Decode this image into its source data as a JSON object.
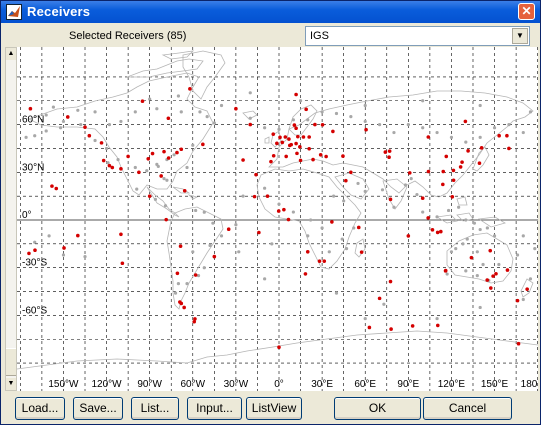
{
  "window": {
    "title": "Receivers",
    "close_glyph": "✕"
  },
  "header": {
    "selected_label": "Selected Receivers (85)"
  },
  "network_select": {
    "value": "IGS",
    "arrow_glyph": "▼"
  },
  "scrollbar": {
    "up_glyph": "▲",
    "down_glyph": "▼"
  },
  "map": {
    "lat_labels": [
      "60°N",
      "30°N",
      "0°",
      "-30°S",
      "-60°S"
    ],
    "lon_labels": [
      "150°W",
      "120°W",
      "90°W",
      "60°W",
      "30°W",
      "0°",
      "30°E",
      "60°E",
      "90°E",
      "120°E",
      "150°E",
      "180"
    ],
    "colors": {
      "grid": "#000000",
      "coast": "#b5b5b5",
      "receiver": "#d40000",
      "candidate": "#a8a8a8"
    },
    "selected_receivers": [
      [
        -147,
        64.8
      ],
      [
        -135,
        58.4
      ],
      [
        -123.5,
        48.5
      ],
      [
        -122,
        37.4
      ],
      [
        -118,
        34.2
      ],
      [
        -116,
        33
      ],
      [
        -110,
        32.2
      ],
      [
        -105,
        40
      ],
      [
        -97.5,
        30
      ],
      [
        -91,
        38.5
      ],
      [
        -88,
        41.8
      ],
      [
        -80,
        43
      ],
      [
        -76.8,
        39
      ],
      [
        -71,
        42.4
      ],
      [
        -68,
        44.5
      ],
      [
        -82,
        27.7
      ],
      [
        -65.6,
        18.4
      ],
      [
        -77,
        64
      ],
      [
        -62,
        82.5
      ],
      [
        -95,
        74.7
      ],
      [
        -53,
        47.6
      ],
      [
        -45,
        -23
      ],
      [
        -35,
        -5.8
      ],
      [
        -58,
        -34.6
      ],
      [
        -68.5,
        -16.5
      ],
      [
        -78.5,
        0.2
      ],
      [
        -70.7,
        -33.5
      ],
      [
        -69,
        -51.6
      ],
      [
        -68,
        -52.5
      ],
      [
        -59,
        -64
      ],
      [
        -66,
        -55
      ],
      [
        -140,
        -9.8
      ],
      [
        -155,
        19.8
      ],
      [
        -158,
        21.3
      ],
      [
        -149.6,
        -17.6
      ],
      [
        -109,
        -27.2
      ],
      [
        -25,
        37.7
      ],
      [
        -16,
        28.5
      ],
      [
        -17,
        14.7
      ],
      [
        -14,
        -7.9
      ],
      [
        -5.6,
        36.7
      ],
      [
        -3.7,
        40.4
      ],
      [
        2.3,
        48.8
      ],
      [
        -1.5,
        48.2
      ],
      [
        0.7,
        52
      ],
      [
        4.4,
        52.2
      ],
      [
        6.9,
        50.9
      ],
      [
        8.5,
        47.4
      ],
      [
        11.9,
        48.1
      ],
      [
        13.1,
        52.4
      ],
      [
        7.5,
        46.9
      ],
      [
        11.9,
        57.7
      ],
      [
        10.7,
        59.7
      ],
      [
        18.9,
        69.6
      ],
      [
        11.9,
        78.9
      ],
      [
        17,
        52.2
      ],
      [
        21,
        52.2
      ],
      [
        21,
        44.8
      ],
      [
        14.5,
        46
      ],
      [
        12.5,
        41.9
      ],
      [
        15,
        37.5
      ],
      [
        23.7,
        38
      ],
      [
        30.3,
        59.9
      ],
      [
        37.5,
        55.7
      ],
      [
        32.8,
        39.9
      ],
      [
        29,
        41
      ],
      [
        36.8,
        -1.2
      ],
      [
        31.5,
        -25.9
      ],
      [
        28.2,
        -25.9
      ],
      [
        18.4,
        -33.9
      ],
      [
        6.6,
        0.3
      ],
      [
        -0.2,
        5.6
      ],
      [
        3.4,
        6.5
      ],
      [
        46.5,
        24.7
      ],
      [
        57.5,
        -20.2
      ],
      [
        70,
        -49.3
      ],
      [
        77.6,
        13
      ],
      [
        77,
        43.3
      ],
      [
        76.6,
        39.5
      ],
      [
        74,
        42.7
      ],
      [
        91,
        29.6
      ],
      [
        104,
        30.5
      ],
      [
        114.3,
        30.5
      ],
      [
        116.4,
        40
      ],
      [
        121.4,
        31.2
      ],
      [
        126.4,
        33.4
      ],
      [
        127.4,
        36.4
      ],
      [
        139.5,
        35.7
      ],
      [
        141,
        45.4
      ],
      [
        131.6,
        43.5
      ],
      [
        153.2,
        53
      ],
      [
        158.6,
        53
      ],
      [
        114,
        22.4
      ],
      [
        121.5,
        25
      ],
      [
        120.6,
        14.6
      ],
      [
        103.8,
        1.3
      ],
      [
        106.8,
        -6.2
      ],
      [
        110.4,
        -7.8
      ],
      [
        112.6,
        -7.3
      ],
      [
        115.9,
        -32
      ],
      [
        116,
        -31.8
      ],
      [
        133.9,
        -23.7
      ],
      [
        147,
        -19.3
      ],
      [
        149,
        -35.3
      ],
      [
        151,
        -33.8
      ],
      [
        144.9,
        -37.8
      ],
      [
        147.4,
        -42.8
      ],
      [
        159,
        -31.5
      ],
      [
        166.7,
        -77.8
      ],
      [
        172.7,
        -43.5
      ],
      [
        -174,
        -21
      ],
      [
        -169.8,
        -19
      ],
      [
        62.9,
        -67.6
      ],
      [
        78,
        -68.6
      ],
      [
        93,
        -66.6
      ],
      [
        110.5,
        -66.3
      ],
      [
        77.6,
        -38.7
      ],
      [
        166,
        -50.7
      ],
      [
        -58.5,
        -62.2
      ],
      [
        -110,
        -9
      ],
      [
        60.6,
        56.8
      ],
      [
        103.9,
        52.2
      ],
      [
        129.7,
        62
      ],
      [
        100,
        13.7
      ],
      [
        55.5,
        -4.7
      ],
      [
        44.5,
        40.2
      ],
      [
        -173,
        70
      ],
      [
        160,
        45
      ],
      [
        -4,
        54
      ],
      [
        0,
        -80
      ],
      [
        -20,
        60
      ],
      [
        -30,
        70
      ],
      [
        20,
        -20
      ],
      [
        5,
        40
      ],
      [
        25,
        60
      ],
      [
        50,
        30
      ],
      [
        -90,
        15
      ],
      [
        90,
        -10
      ],
      [
        -8,
        15
      ],
      [
        -132,
        53
      ]
    ],
    "candidate_receivers": [
      [
        -150,
        62
      ],
      [
        -138,
        60
      ],
      [
        -128,
        50
      ],
      [
        -120,
        45
      ],
      [
        -119,
        36
      ],
      [
        -112,
        38
      ],
      [
        -100,
        33
      ],
      [
        -92,
        31
      ],
      [
        -85,
        35
      ],
      [
        -84,
        33.7
      ],
      [
        -78,
        38
      ],
      [
        -73,
        41
      ],
      [
        -60,
        47
      ],
      [
        -64,
        33
      ],
      [
        -80,
        26
      ],
      [
        -99,
        19.4
      ],
      [
        -86,
        13
      ],
      [
        -79,
        9
      ],
      [
        -58,
        6
      ],
      [
        -52,
        4.9
      ],
      [
        -46,
        -2
      ],
      [
        -40,
        -10
      ],
      [
        -48,
        -16
      ],
      [
        -52,
        -30
      ],
      [
        -60,
        -20
      ],
      [
        -70,
        -40
      ],
      [
        -72,
        -46
      ],
      [
        -56,
        -35
      ],
      [
        -64,
        -40
      ],
      [
        -152,
        58
      ],
      [
        -162,
        66
      ],
      [
        -157,
        71
      ],
      [
        -78,
        25
      ],
      [
        -25,
        15
      ],
      [
        -10,
        20
      ],
      [
        0,
        10
      ],
      [
        10,
        5
      ],
      [
        22,
        0
      ],
      [
        30,
        -5
      ],
      [
        20,
        -10
      ],
      [
        35,
        -20
      ],
      [
        44,
        -12
      ],
      [
        52,
        -5
      ],
      [
        47,
        -18
      ],
      [
        38,
        15
      ],
      [
        45,
        12
      ],
      [
        55,
        23
      ],
      [
        60,
        18
      ],
      [
        72,
        19
      ],
      [
        80,
        8
      ],
      [
        88,
        22
      ],
      [
        92,
        26
      ],
      [
        96,
        16
      ],
      [
        100,
        5
      ],
      [
        110,
        2
      ],
      [
        118,
        6
      ],
      [
        125,
        8
      ],
      [
        130,
        0
      ],
      [
        136,
        -2
      ],
      [
        140,
        -6
      ],
      [
        145,
        -5
      ],
      [
        150,
        -10
      ],
      [
        120,
        -20
      ],
      [
        123,
        -18
      ],
      [
        128,
        -15
      ],
      [
        131,
        -12
      ],
      [
        138,
        -20
      ],
      [
        142,
        -28
      ],
      [
        138,
        -35
      ],
      [
        130,
        -32
      ],
      [
        117,
        -34
      ],
      [
        153,
        -28
      ],
      [
        146,
        -38
      ],
      [
        175,
        -37
      ],
      [
        178,
        -18
      ],
      [
        166,
        -22
      ],
      [
        170,
        -10
      ],
      [
        -170,
        -14
      ],
      [
        -150,
        -22
      ],
      [
        -160,
        -10
      ],
      [
        -135,
        -23
      ],
      [
        -176,
        52
      ],
      [
        170,
        55
      ],
      [
        160,
        60
      ],
      [
        150,
        58
      ],
      [
        140,
        52
      ],
      [
        130,
        49
      ],
      [
        120,
        52
      ],
      [
        110,
        55
      ],
      [
        100,
        58
      ],
      [
        90,
        60
      ],
      [
        80,
        55
      ],
      [
        70,
        60
      ],
      [
        60,
        62
      ],
      [
        50,
        65
      ],
      [
        40,
        67
      ],
      [
        30,
        68
      ],
      [
        20,
        63
      ],
      [
        10,
        63
      ],
      [
        0,
        57
      ],
      [
        -10,
        58
      ],
      [
        -20,
        64
      ],
      [
        -45,
        61
      ],
      [
        -50,
        65
      ],
      [
        -55,
        68
      ],
      [
        -68,
        68
      ],
      [
        -85,
        70
      ],
      [
        -100,
        68
      ],
      [
        -110,
        62
      ],
      [
        -118,
        60
      ],
      [
        -128,
        68
      ],
      [
        -140,
        69
      ],
      [
        -162,
        56
      ],
      [
        -170,
        53
      ],
      [
        -90,
        76
      ],
      [
        -70,
        78
      ],
      [
        -40,
        72
      ],
      [
        -20,
        80
      ],
      [
        15,
        75
      ],
      [
        60,
        72
      ],
      [
        100,
        75
      ],
      [
        140,
        72
      ],
      [
        175,
        68
      ],
      [
        40,
        -46
      ],
      [
        -10,
        -37
      ],
      [
        -5,
        -15
      ],
      [
        -30,
        -3
      ],
      [
        -28,
        -20
      ],
      [
        73,
        -53
      ],
      [
        170,
        -50
      ],
      [
        140,
        -55
      ],
      [
        110,
        -62
      ],
      [
        60,
        -62
      ]
    ]
  }
}
